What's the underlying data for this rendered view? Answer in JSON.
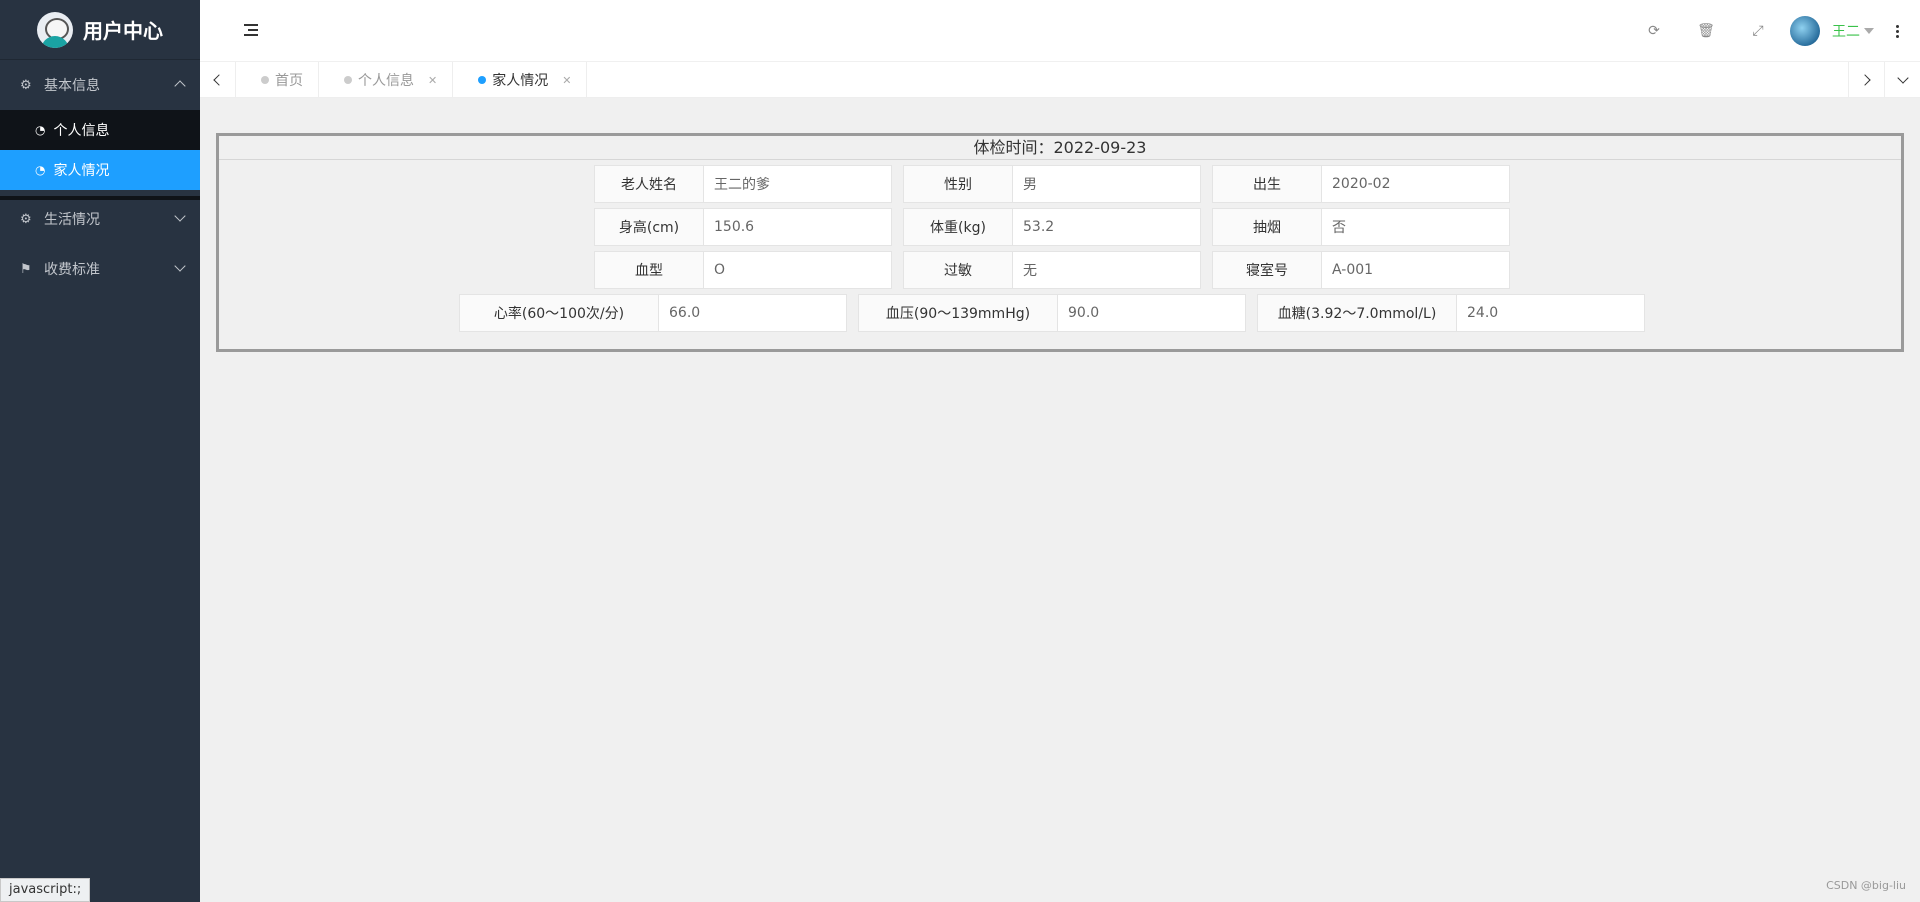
{
  "app": {
    "title": "用户中心"
  },
  "sidebar": {
    "groups": [
      {
        "label": "基本信息",
        "expanded": true,
        "items": [
          {
            "label": "个人信息",
            "active": false
          },
          {
            "label": "家人情况",
            "active": true
          }
        ]
      },
      {
        "label": "生活情况",
        "expanded": false,
        "items": []
      },
      {
        "label": "收费标准",
        "expanded": false,
        "items": []
      }
    ]
  },
  "header": {
    "user_name": "王二",
    "icons": [
      "refresh-icon",
      "trash-icon",
      "fullscreen-icon"
    ]
  },
  "tabs": [
    {
      "label": "首页",
      "active": false,
      "closable": false
    },
    {
      "label": "个人信息",
      "active": false,
      "closable": true
    },
    {
      "label": "家人情况",
      "active": true,
      "closable": true
    }
  ],
  "exam": {
    "title": "体检时间：2022-09-23",
    "name_label": "老人姓名",
    "name_value": "王二的爹",
    "gender_label": "性别",
    "gender_value": "男",
    "birth_label": "出生",
    "birth_value": "2020-02",
    "height_label": "身高(cm)",
    "height_value": "150.6",
    "weight_label": "体重(kg)",
    "weight_value": "53.2",
    "smoke_label": "抽烟",
    "smoke_value": "否",
    "blood_label": "血型",
    "blood_value": "O",
    "allergy_label": "过敏",
    "allergy_value": "无",
    "room_label": "寝室号",
    "room_value": "A-001",
    "heart_label": "心率(60～100次/分)",
    "heart_value": "66.0",
    "pressure_label": "血压(90～139mmHg)",
    "pressure_value": "90.0",
    "sugar_label": "血糖(3.92～7.0mmol/L)",
    "sugar_value": "24.0"
  },
  "status": {
    "text": "javascript:;"
  },
  "watermark": "CSDN @big-liu",
  "colors": {
    "sidebar_bg": "#283341",
    "active_blue": "#1e9fff",
    "user_green": "#3ac24a"
  }
}
